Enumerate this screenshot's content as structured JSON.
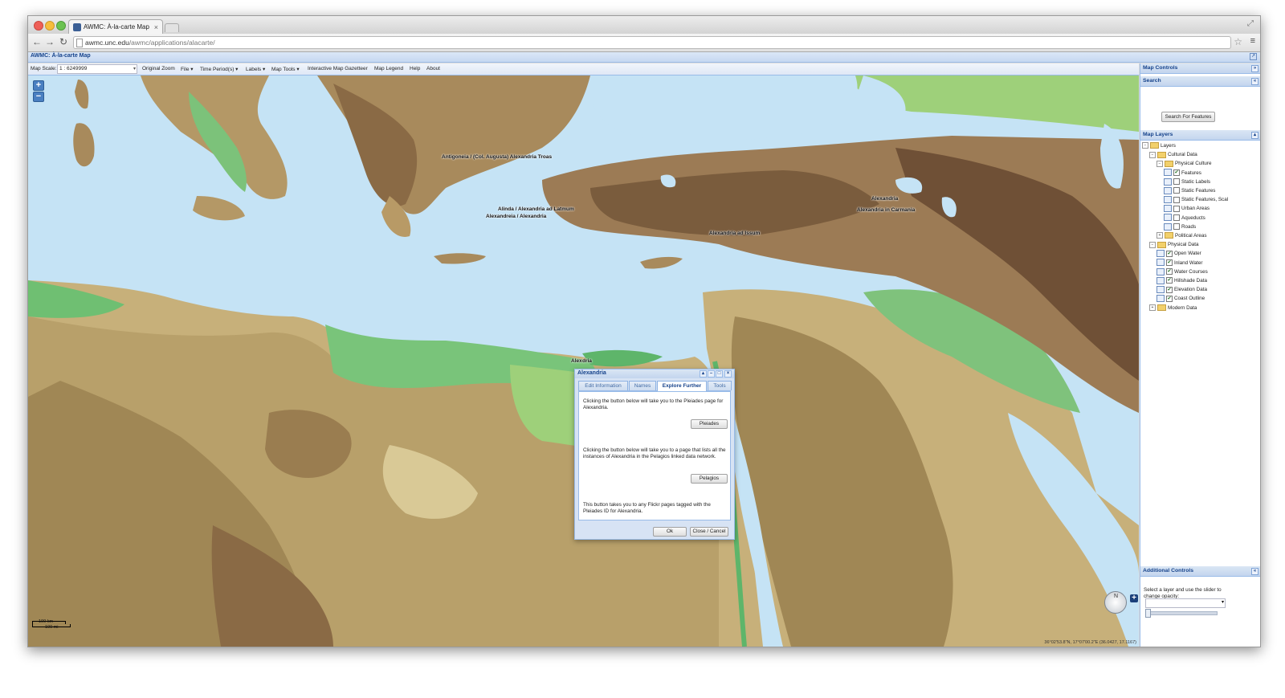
{
  "browser": {
    "tab_title": "AWMC: À-la-carte Map",
    "tab_close": "×",
    "url_host": "awmc.unc.edu",
    "url_path": "/awmc/applications/alacarte/",
    "back": "←",
    "forward": "→",
    "reload": "↻",
    "star": "☆",
    "menu": "≡",
    "resize": "⤢"
  },
  "app": {
    "title": "AWMC: À-la-carte Map",
    "collapse": "↗"
  },
  "menubar": {
    "scale_label": "Map Scale:",
    "scale_value": "1 : 6249999",
    "items": [
      "Original Zoom",
      "File ▾",
      "Time Period(s) ▾",
      "Labels ▾",
      "Map Tools ▾",
      "Interactive Map Gazetteer",
      "Map Legend",
      "Help",
      "About"
    ]
  },
  "map": {
    "zoom_in": "+",
    "zoom_out": "−",
    "labels": [
      "Antigoneia / (Col. Augusta) Alexandria Troas",
      "Alinda / Alexandria ad Latmum",
      "Alexandreia / Alexandria",
      "Alexandria",
      "Alexandria in Carmania",
      "Alexandria ad Issum",
      "Alex",
      "dria"
    ],
    "scale_top": "100 km",
    "scale_bottom": "100 mi",
    "coords": "36°02'53.8\"N, 17°07'00.2\"E (36.0427, 17.1167)",
    "compass_n": "N",
    "plus": "+"
  },
  "dialog": {
    "title": "Alexandria",
    "controls": [
      "▴",
      "–",
      "□",
      "×"
    ],
    "tabs": [
      "Edit Information",
      "Names",
      "Explore Further",
      "Tools"
    ],
    "active_tab": "Explore Further",
    "para1": "Clicking the button below will take you to the Pleiades page for Alexandria.",
    "btn_pleiades": "Pleiades",
    "para2": "Clicking the button below will take you to a page that lists all the instances of Alexandria in the Pelagios linked data network.",
    "btn_pelagios": "Pelagios",
    "para3": "This button takes you to any Flickr pages tagged with the Pleiades ID for Alexandria.",
    "btn_ok": "Ok",
    "btn_close": "Close / Cancel"
  },
  "panel": {
    "title": "Map Controls",
    "collapse": "»",
    "search_title": "Search",
    "search_collapse": "«",
    "search_button": "Search For Features",
    "layers_title": "Map Layers",
    "layers_collapse": "▴",
    "tree": [
      {
        "label": "Layers",
        "level": 0,
        "kind": "folder",
        "toggle": "−"
      },
      {
        "label": "Cultural Data",
        "level": 1,
        "kind": "folder",
        "toggle": "−"
      },
      {
        "label": "Physical Culture",
        "level": 2,
        "kind": "folder",
        "toggle": "−"
      },
      {
        "label": "Features",
        "level": 3,
        "kind": "leaf",
        "checked": true
      },
      {
        "label": "Static Labels",
        "level": 3,
        "kind": "leaf",
        "checked": false
      },
      {
        "label": "Static Features",
        "level": 3,
        "kind": "leaf",
        "checked": false
      },
      {
        "label": "Static Features, Scal",
        "level": 3,
        "kind": "leaf",
        "checked": false
      },
      {
        "label": "Urban Areas",
        "level": 3,
        "kind": "leaf",
        "checked": false
      },
      {
        "label": "Aqueducts",
        "level": 3,
        "kind": "leaf",
        "checked": false
      },
      {
        "label": "Roads",
        "level": 3,
        "kind": "leaf",
        "checked": false
      },
      {
        "label": "Political Areas",
        "level": 2,
        "kind": "folder",
        "toggle": "+"
      },
      {
        "label": "Physical Data",
        "level": 1,
        "kind": "folder",
        "toggle": "−"
      },
      {
        "label": "Open Water",
        "level": 2,
        "kind": "leaf",
        "checked": true
      },
      {
        "label": "Inland Water",
        "level": 2,
        "kind": "leaf",
        "checked": true
      },
      {
        "label": "Water Courses",
        "level": 2,
        "kind": "leaf",
        "checked": true
      },
      {
        "label": "Hillshade Data",
        "level": 2,
        "kind": "leaf",
        "checked": true
      },
      {
        "label": "Elevation Data",
        "level": 2,
        "kind": "leaf",
        "checked": true
      },
      {
        "label": "Coast Outline",
        "level": 2,
        "kind": "leaf",
        "checked": true
      },
      {
        "label": "Modern Data",
        "level": 1,
        "kind": "folder",
        "toggle": "+"
      }
    ],
    "additional_title": "Additional Controls",
    "additional_collapse": "«",
    "opacity_text": "Select a layer and use the slider to change opacity:",
    "opacity_arrow": "▾"
  }
}
